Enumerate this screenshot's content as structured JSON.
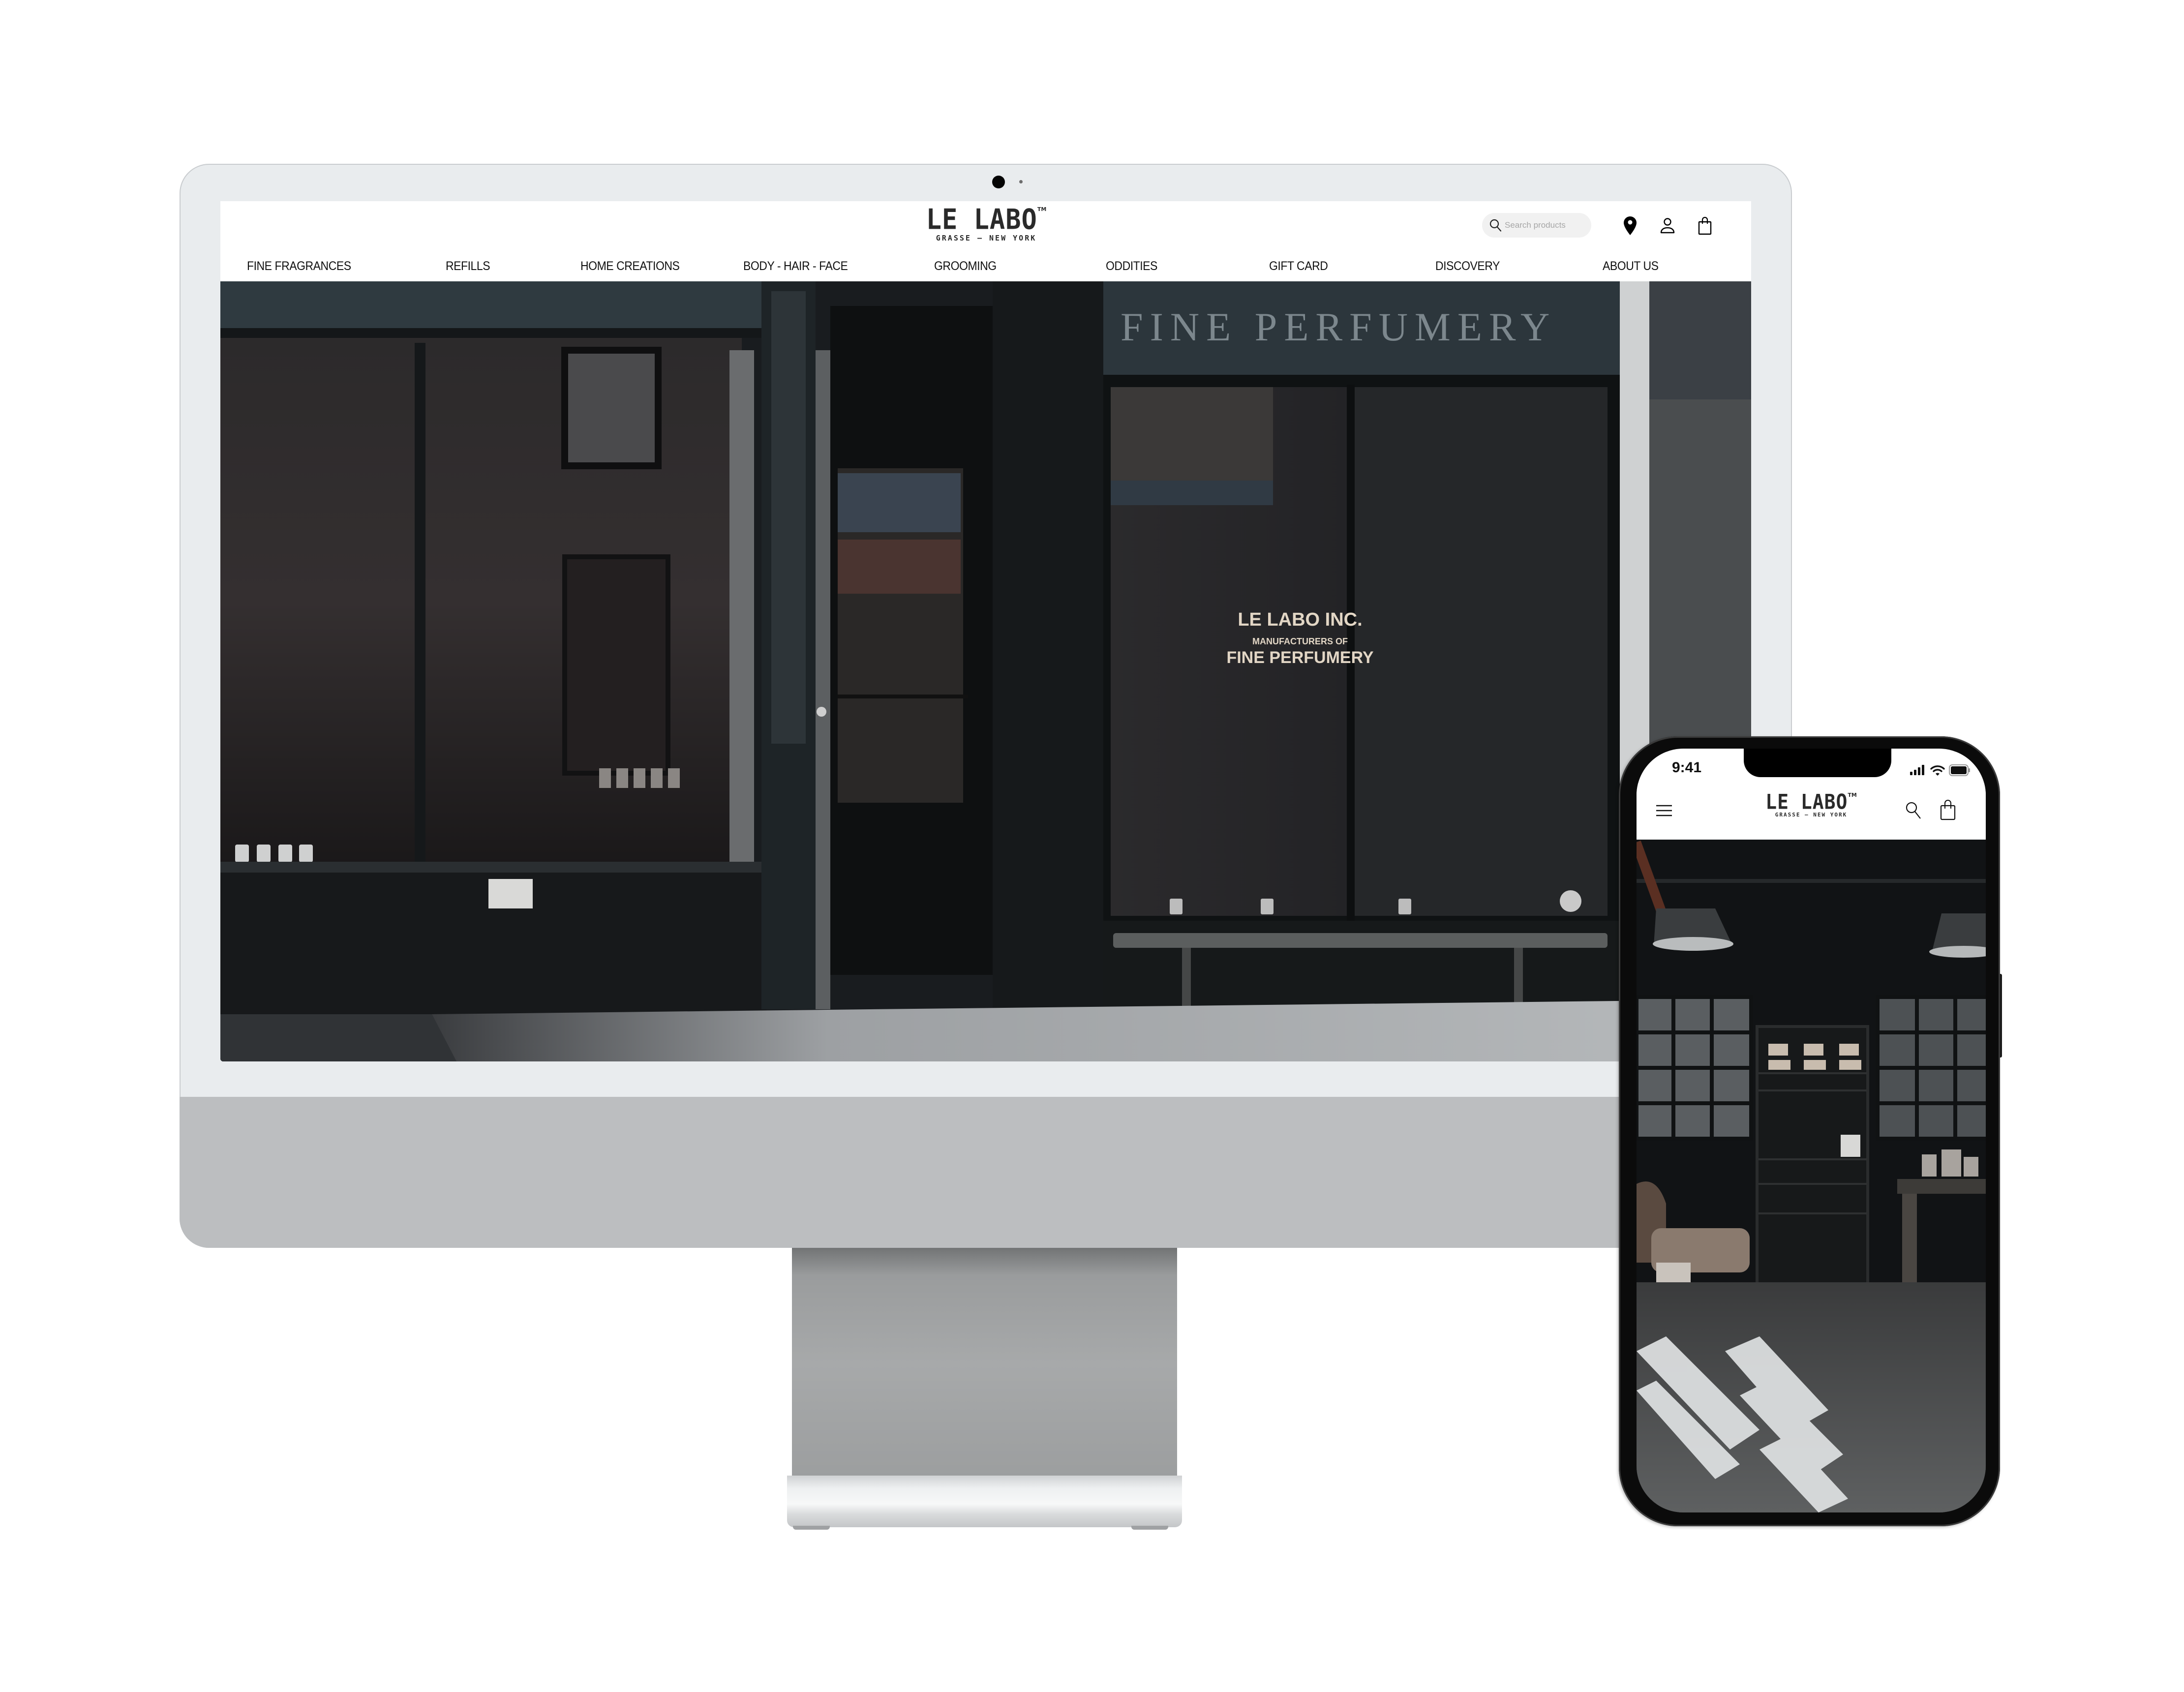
{
  "site": {
    "brand": "LE LABO",
    "brand_tm": "TM",
    "tagline": "GRASSE — NEW YORK"
  },
  "desktop": {
    "search": {
      "placeholder": "Search products",
      "icon": "search-icon"
    },
    "header_icons": [
      "location-pin-icon",
      "account-icon",
      "shopping-bag-icon"
    ],
    "nav": [
      {
        "label": "FINE FRAGRANCES"
      },
      {
        "label": "REFILLS"
      },
      {
        "label": "HOME CREATIONS"
      },
      {
        "label": "BODY - HAIR - FACE"
      },
      {
        "label": "GROOMING"
      },
      {
        "label": "ODDITIES"
      },
      {
        "label": "GIFT CARD"
      },
      {
        "label": "DISCOVERY"
      },
      {
        "label": "ABOUT US"
      }
    ],
    "hero": {
      "sign_text": "FINE PERFUMERY",
      "window_decal_line1": "LE LABO INC.",
      "window_decal_line2": "MANUFACTURERS OF",
      "window_decal_line3": "FINE PERFUMERY"
    }
  },
  "mobile": {
    "status_bar": {
      "time": "9:41",
      "icons": [
        "signal-icon",
        "wifi-icon",
        "battery-icon"
      ]
    },
    "header_icons": [
      "menu-icon",
      "search-icon",
      "shopping-bag-icon"
    ]
  },
  "colors": {
    "text": "#111111",
    "logo": "#2a2a2a",
    "search_bg": "#f1f1f1",
    "placeholder": "#a6a6a6",
    "bezel": "#e9ecee",
    "chin": "#bcbec0"
  }
}
